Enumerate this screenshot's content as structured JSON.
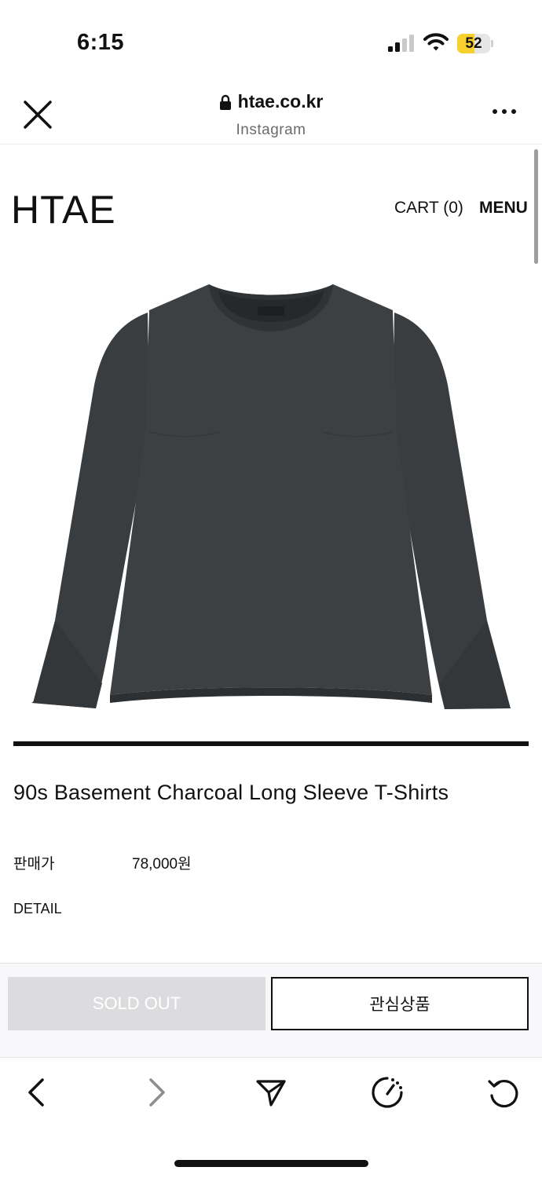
{
  "status_bar": {
    "time": "6:15",
    "battery": "52",
    "battery_level": 0.52
  },
  "browser": {
    "url": "htae.co.kr",
    "source": "Instagram"
  },
  "site": {
    "logo": "HTAE",
    "cart": "CART (0)",
    "menu": "MENU"
  },
  "product": {
    "title": "90s Basement Charcoal Long Sleeve T-Shirts",
    "price_label": "판매가",
    "price": "78,000원",
    "detail": "DETAIL"
  },
  "actions": {
    "sold_out": "SOLD OUT",
    "wishlist": "관심상품"
  },
  "colors": {
    "garment": "#3a3d40",
    "battery": "#f7d02e",
    "sold_out_bg": "#dcdcdf"
  },
  "icons": {
    "close": "close-icon",
    "lock": "lock-icon",
    "more": "more-icon",
    "back": "chevron-left-icon",
    "forward": "chevron-right-icon",
    "share": "send-icon",
    "speed": "gauge-icon",
    "reload": "reload-icon"
  }
}
